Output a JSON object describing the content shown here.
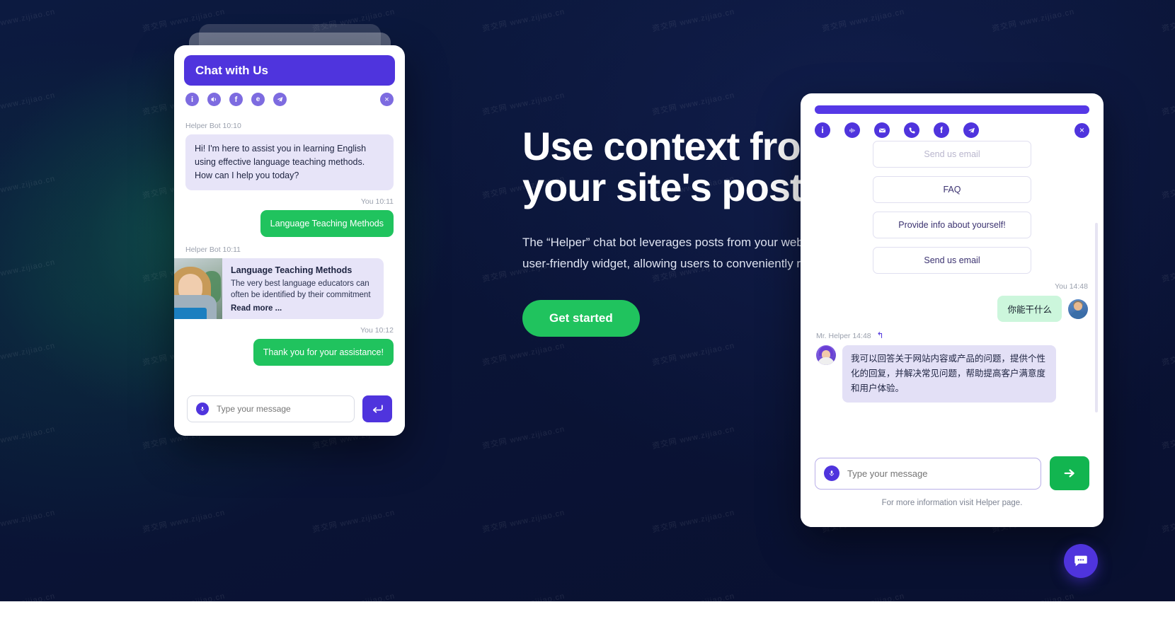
{
  "hero": {
    "heading_line1": "Use context from",
    "heading_line2": "your site's posts",
    "paragraph": "The “Helper” chat bot leverages posts from your website and presents the information in a user-friendly widget, allowing users to conveniently read and access relevant content.",
    "cta_label": "Get started",
    "accent_green": "#20c35e",
    "accent_purple": "#4f34dd",
    "background": "#0b1637"
  },
  "watermark": {
    "text": "资交网 www.zijiao.cn"
  },
  "left_widget": {
    "title": "Chat with Us",
    "icons": [
      "info-icon",
      "voice-icon",
      "facebook-icon",
      "skype-icon",
      "telegram-icon"
    ],
    "close_label": "×",
    "messages": [
      {
        "meta": "Helper Bot 10:10",
        "side": "bot",
        "text": "Hi! I'm here to assist you in learning English using effective language teaching methods. How can I help you today?"
      },
      {
        "meta": "You 10:11",
        "side": "me",
        "text": "Language Teaching Methods"
      },
      {
        "meta": "Helper Bot 10:11",
        "side": "card"
      },
      {
        "meta": "You 10:12",
        "side": "me",
        "text": "Thank you for your assistance!"
      }
    ],
    "post_card": {
      "title": "Language Teaching Methods",
      "description": "The very best language educators can often be identified by their commitment",
      "read_more": "Read more ..."
    },
    "input_placeholder": "Type your message",
    "mic_icon": "microphone-icon",
    "send_icon": "enter-arrow-icon"
  },
  "right_widget": {
    "icons": [
      "info-icon",
      "voice-icon",
      "email-icon",
      "phone-icon",
      "facebook-icon",
      "telegram-icon"
    ],
    "close_label": "×",
    "quick_replies": [
      {
        "label": "Send us email",
        "faded": true
      },
      {
        "label": "FAQ",
        "faded": false
      },
      {
        "label": "Provide info about yourself!",
        "faded": false
      },
      {
        "label": "Send us email",
        "faded": false
      }
    ],
    "messages": [
      {
        "meta": "You  14:48",
        "side": "me",
        "text": "你能干什么"
      },
      {
        "meta": "Mr. Helper 14:48",
        "side": "bot",
        "text": "我可以回答关于网站内容或产品的问题，提供个性化的回复，并解决常见问题，帮助提高客户满意度和用户体验。"
      }
    ],
    "input_placeholder": "Type your message",
    "mic_icon": "microphone-icon",
    "send_icon": "arrow-right-icon",
    "footer_note": "For more information visit Helper page."
  },
  "launcher": {
    "icon": "chat-bubble-icon"
  }
}
